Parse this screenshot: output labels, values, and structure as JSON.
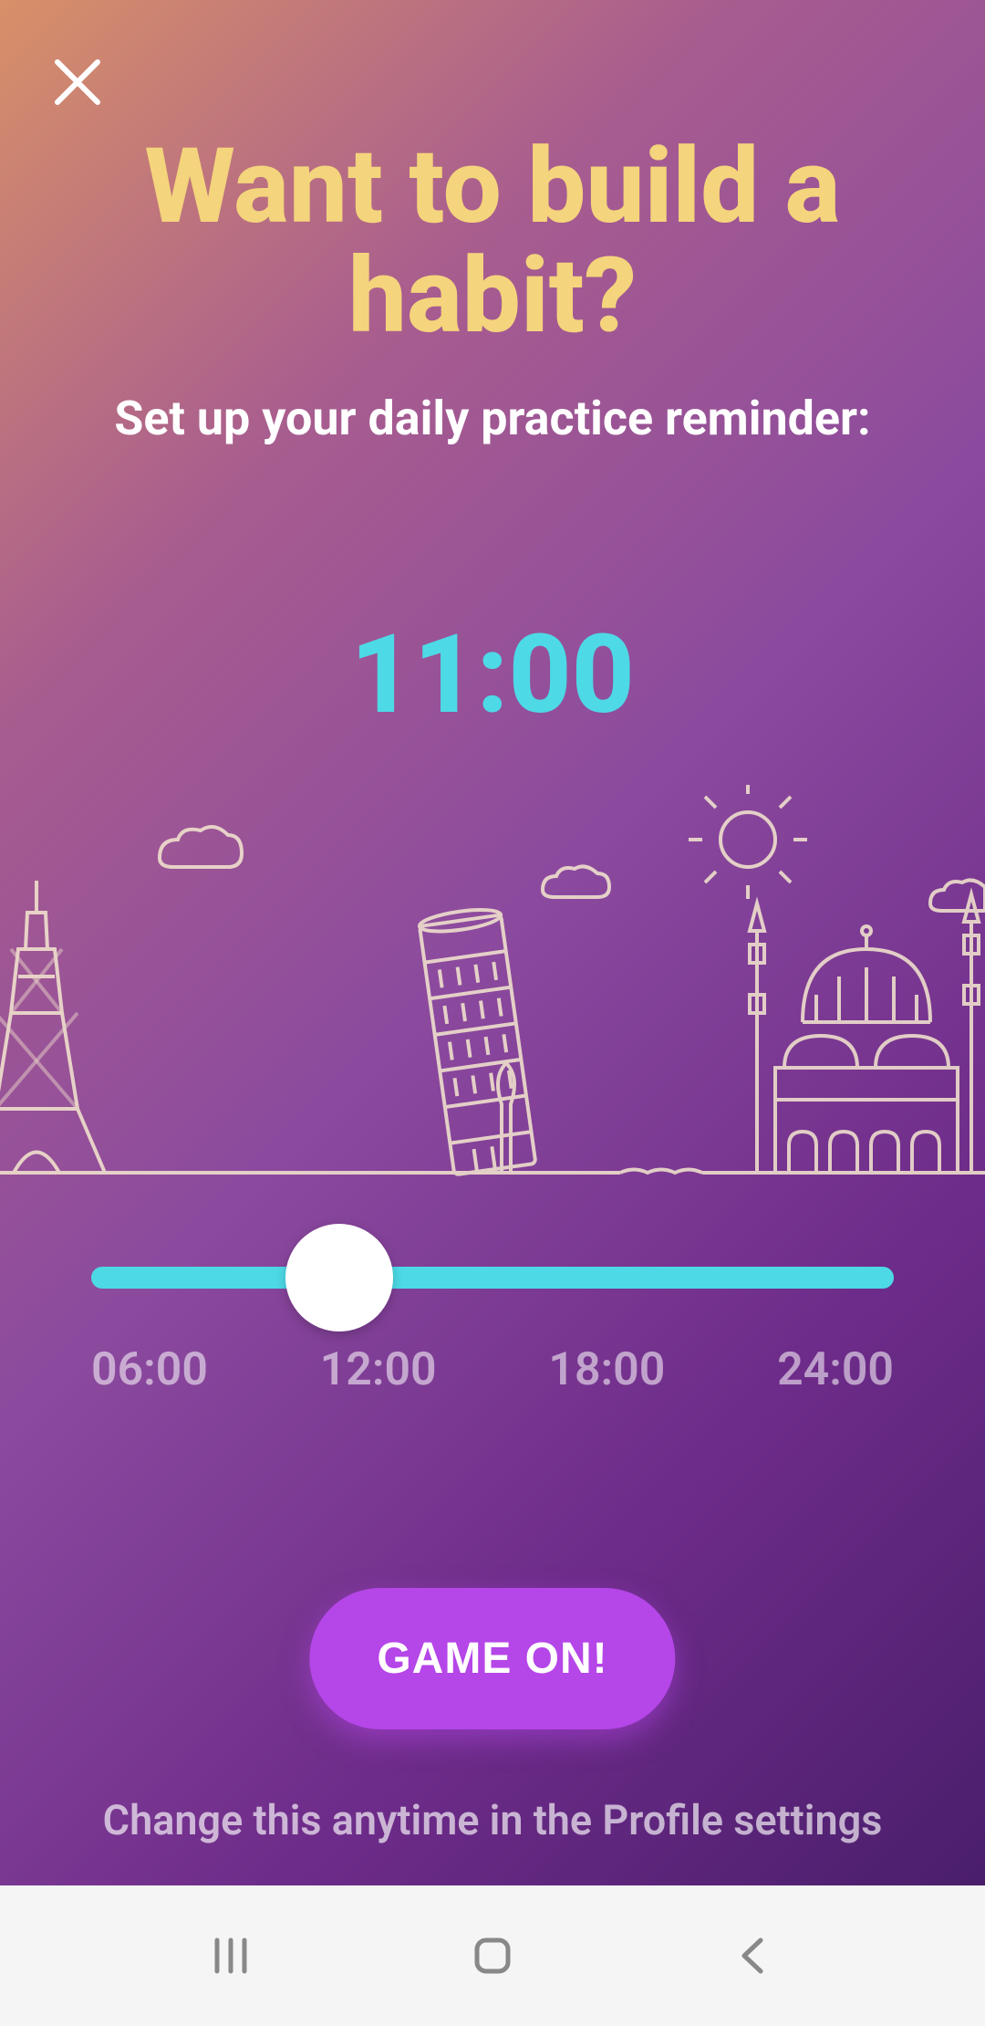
{
  "title": "Want to build a habit?",
  "subtitle": "Set up your daily practice reminder:",
  "selected_time": "11:00",
  "slider": {
    "min": "06:00",
    "max": "24:00",
    "labels": [
      "06:00",
      "12:00",
      "18:00",
      "24:00"
    ],
    "value_position_percent": 27.8
  },
  "cta_label": "GAME ON!",
  "footer_text": "Change this anytime in the Profile settings",
  "colors": {
    "accent_yellow": "#f4d47c",
    "accent_cyan": "#4dd9e6",
    "cta_purple": "#b546e8"
  }
}
